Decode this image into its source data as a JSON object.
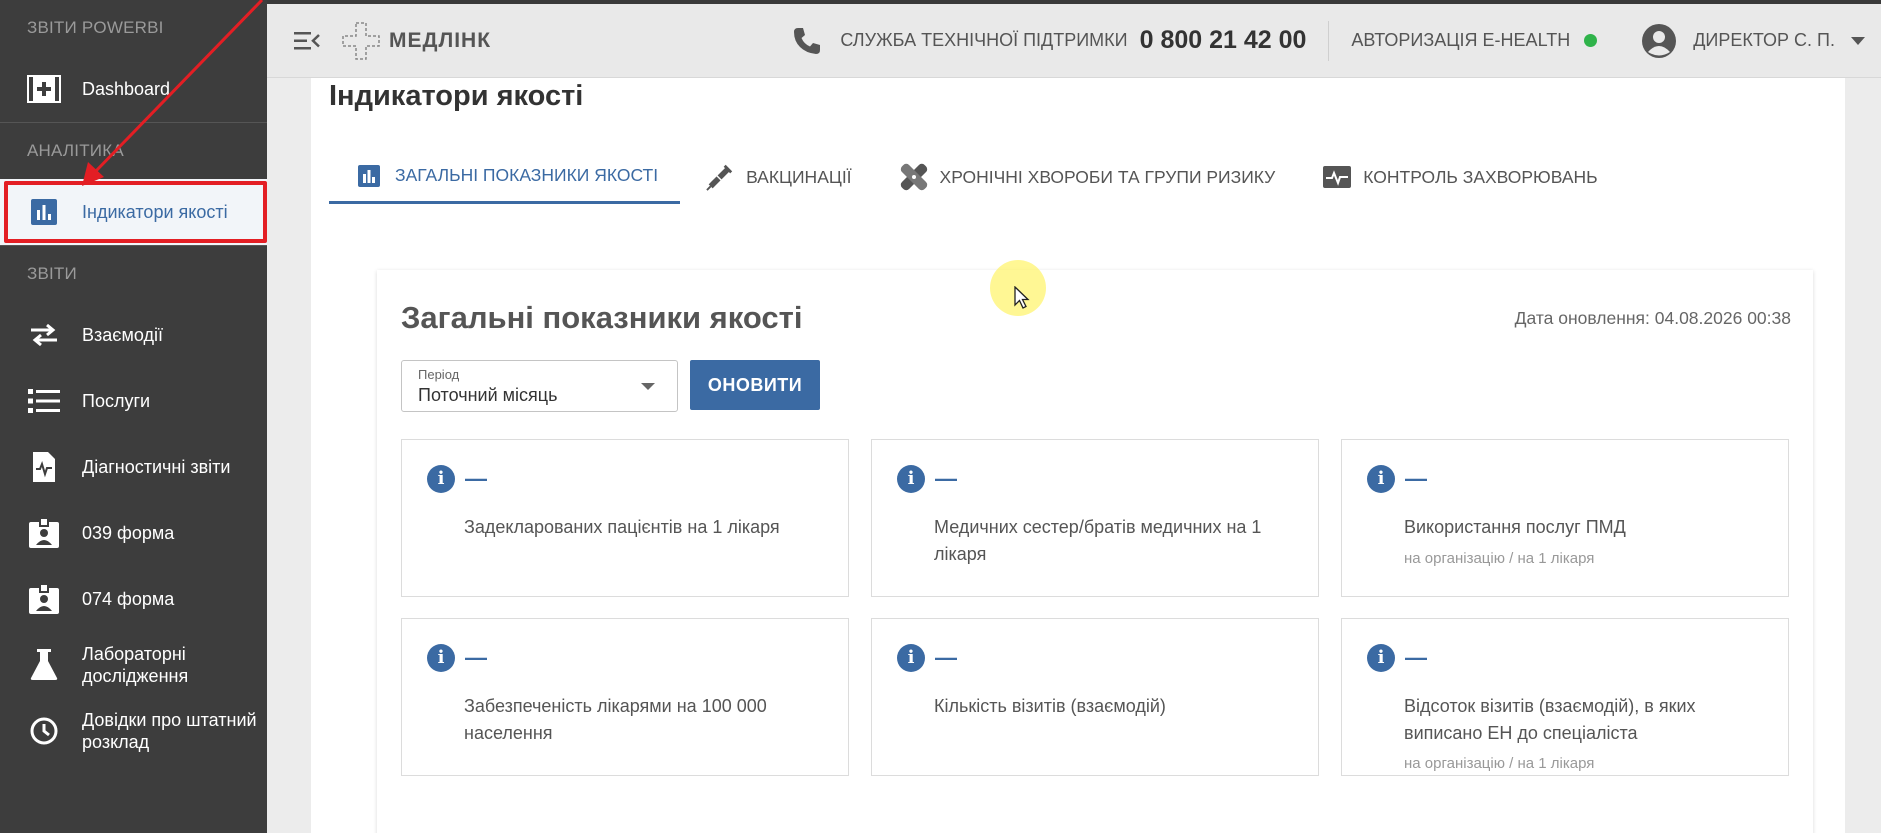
{
  "app": {
    "brand": "МЕДЛІНК"
  },
  "topbar": {
    "support_label": "СЛУЖБА ТЕХНІЧНОЇ ПІДТРИМКИ",
    "support_phone": "0 800 21 42 00",
    "ehealth_label": "АВТОРИЗАЦІЯ E-HEALTH",
    "ehealth_status_color": "#2fb34a",
    "user_name": "ДИРЕКТОР С. П."
  },
  "sidebar": {
    "sections": [
      {
        "title": "ЗВІТИ POWERBI",
        "items": [
          {
            "label": "Dashboard",
            "icon": "plus-box-icon"
          }
        ]
      },
      {
        "title": "АНАЛІТИКА",
        "items": [
          {
            "label": "Індикатори якості",
            "icon": "bar-chart-icon",
            "active": true
          }
        ]
      },
      {
        "title": "ЗВІТИ",
        "items": [
          {
            "label": "Взаємодії",
            "icon": "swap-arrows-icon"
          },
          {
            "label": "Послуги",
            "icon": "list-icon"
          },
          {
            "label": "Діагностичні звіти",
            "icon": "diagnostic-doc-icon"
          },
          {
            "label": "039 форма",
            "icon": "id-badge-icon"
          },
          {
            "label": "074 форма",
            "icon": "id-badge-icon"
          },
          {
            "label": "Лабораторні дослідження",
            "icon": "flask-icon"
          },
          {
            "label": "Довідки про штатний розклад",
            "icon": "clock-icon"
          }
        ]
      }
    ]
  },
  "page": {
    "title": "Індикатори якості",
    "tabs": [
      {
        "label": "ЗАГАЛЬНІ ПОКАЗНИКИ ЯКОСТІ",
        "icon": "bar-chart-icon",
        "active": true
      },
      {
        "label": "ВАКЦИНАЦІЇ",
        "icon": "syringe-icon"
      },
      {
        "label": "ХРОНІЧНІ ХВОРОБИ ТА ГРУПИ РИЗИКУ",
        "icon": "bandage-icon"
      },
      {
        "label": "КОНТРОЛЬ ЗАХВОРЮВАНЬ",
        "icon": "pulse-monitor-icon"
      }
    ]
  },
  "card": {
    "title": "Загальні показники якості",
    "update_label": "Дата оновлення: 04.08.2026 00:38",
    "period": {
      "label": "Період",
      "value": "Поточний місяць"
    },
    "refresh_label": "ОНОВИТИ",
    "tiles": [
      {
        "value": "—",
        "label": "Задекларованих пацієнтів на 1 лікаря",
        "sub": ""
      },
      {
        "value": "—",
        "label": "Медичних сестер/братів медичних на 1 лікаря",
        "sub": ""
      },
      {
        "value": "—",
        "label": "Використання послуг ПМД",
        "sub": "на організацію / на 1 лікаря"
      },
      {
        "value": "—",
        "label": "Забезпеченість лікарями на 100 000 населення",
        "sub": ""
      },
      {
        "value": "—",
        "label": "Кількість візитів (взаємодій)",
        "sub": ""
      },
      {
        "value": "—",
        "label": "Відсоток візитів (взаємодій), в яких виписано ЕН до спеціаліста",
        "sub": "на організацію / на 1 лікаря"
      }
    ]
  },
  "colors": {
    "accent": "#3b6aa3",
    "annotation": "#e31e24",
    "sidebar_bg": "#3d3d3d"
  }
}
